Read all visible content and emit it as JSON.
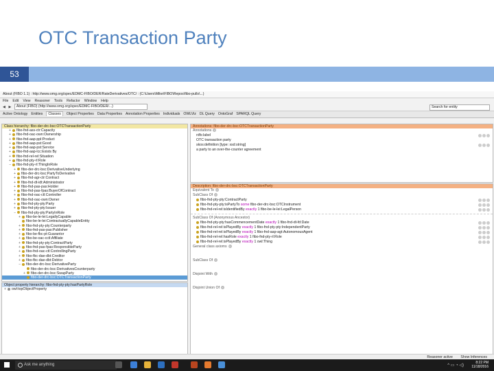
{
  "slide": {
    "title": "OTC Transaction Party",
    "page_number": "53"
  },
  "window": {
    "title": "About (FIBO 1.1) : http://www.omg.org/spec/EDMC-FIBO/DER/RateDerivatives/OTC/ : (C:\\Users\\Mike\\FIBO\\Repos\\fibo-pulls\\...)"
  },
  "menu": [
    "File",
    "Edit",
    "View",
    "Reasoner",
    "Tools",
    "Refactor",
    "Window",
    "Help"
  ],
  "toolbar": {
    "url": "About (FIBO) (http://www.omg.org/spec/EDMC-FIBO/DER/...)",
    "search_placeholder": "Search for entity"
  },
  "tabs": [
    "Active Ontology",
    "Entities",
    "Classes",
    "Object Properties",
    "Data Properties",
    "Annotation Properties",
    "Individuals",
    "OWLViz",
    "DL Query",
    "OntoGraf",
    "SPARQL Query"
  ],
  "active_tab": "Classes",
  "class_hierarchy": {
    "header": "Class hierarchy: fibo-der-drc-bsc:OTCTransactionParty",
    "items": [
      {
        "label": "fibo-fnd-ass-ctr:Capacity",
        "indent": 1,
        "toggle": "+"
      },
      {
        "label": "fibo-fnd-oac-own:Ownership",
        "indent": 1,
        "toggle": "+"
      },
      {
        "label": "fibo-fnd-aap-ppl:Product",
        "indent": 1,
        "toggle": "+"
      },
      {
        "label": "fibo-fnd-aap-pst:Good",
        "indent": 1,
        "toggle": "+"
      },
      {
        "label": "fibo-fnd-aap-pst:Service",
        "indent": 1,
        "toggle": "+"
      },
      {
        "label": "fibo-fnd-aap-lcc:Exists By",
        "indent": 1,
        "toggle": "+"
      },
      {
        "label": "fibo-fnd-rel-rel:Situation",
        "indent": 1,
        "toggle": "+"
      },
      {
        "label": "fibo-fnd-pty-rl:Role",
        "indent": 1,
        "toggle": "+"
      },
      {
        "label": "fibo-fnd-pty-rl:ThingInRole",
        "indent": 1,
        "toggle": "−"
      },
      {
        "label": "fibo-der-drc-bsc:DerivativeUnderlying",
        "indent": 2,
        "toggle": "+"
      },
      {
        "label": "fibo-der-drc-bsc:PartyToDerivative",
        "indent": 2,
        "toggle": "+"
      },
      {
        "label": "fibo-fnd-agr-ctr:Contract",
        "indent": 2,
        "toggle": "+"
      },
      {
        "label": "fibo-fnd-dt-idt:Administrator",
        "indent": 2,
        "toggle": "+"
      },
      {
        "label": "fibo-fnd-pas-pas:Holder",
        "indent": 2,
        "toggle": "+"
      },
      {
        "label": "fibo-fnd-pas-fpas:BuyerOfContract",
        "indent": 2,
        "toggle": "+"
      },
      {
        "label": "fibo-fnd-oac-ctl:Controller",
        "indent": 2,
        "toggle": "+"
      },
      {
        "label": "fibo-fnd-oac-own:Owner",
        "indent": 2,
        "toggle": "+"
      },
      {
        "label": "fibo-fnd-pty-pty:Party",
        "indent": 2,
        "toggle": "+"
      },
      {
        "label": "fibo-fnd-pty-pty:Issuer",
        "indent": 2,
        "toggle": "+"
      },
      {
        "label": "fibo-fnd-pty-pty:PartyInRole",
        "indent": 2,
        "toggle": "−"
      },
      {
        "label": "fibo-be-le-lei:LegallyCapable",
        "indent": 3,
        "toggle": "+"
      },
      {
        "label": "fibo-be-le-lei:ContractuallyCapableEntity",
        "indent": 3,
        "toggle": ""
      },
      {
        "label": "fibo-fnd-pty-pty:Counterparty",
        "indent": 3,
        "toggle": "+"
      },
      {
        "label": "fibo-fnd-pas-pas:Publisher",
        "indent": 3,
        "toggle": "+"
      },
      {
        "label": "fibo-be-fbc-pt:Guarantor",
        "indent": 3,
        "toggle": "+"
      },
      {
        "label": "fibo-be-oac-cctl:Affiliate",
        "indent": 3,
        "toggle": "+"
      },
      {
        "label": "fibo-fnd-pty-pty:ContractParty",
        "indent": 3,
        "toggle": "+"
      },
      {
        "label": "fibo-fnd-pas-fpas:ResponsibleParty",
        "indent": 3,
        "toggle": "+"
      },
      {
        "label": "fibo-fnd-oac-ctl:ControllingParty",
        "indent": 3,
        "toggle": "+"
      },
      {
        "label": "fibo-fbc-dae-dbt:Creditor",
        "indent": 3,
        "toggle": "+"
      },
      {
        "label": "fibo-fbc-dae-dbt:Debtor",
        "indent": 3,
        "toggle": "+"
      },
      {
        "label": "fibo-der-drc-bsc:DerivativeParty",
        "indent": 3,
        "toggle": "−"
      },
      {
        "label": "fibo-der-drc-bsc:DerivativesCounterparty",
        "indent": 4,
        "toggle": ""
      },
      {
        "label": "fibo-der-drc-bsc:SwapParty",
        "indent": 4,
        "toggle": "+"
      },
      {
        "label": "fibo-der-drc-bsc:OTCTransactionParty",
        "indent": 4,
        "toggle": "",
        "selected": true
      }
    ]
  },
  "object_hierarchy": {
    "header": "Object property hierarchy: fibo-fnd-pty-pty:hasPartyRole",
    "items": [
      {
        "label": "owl:topObjectProperty",
        "indent": 0,
        "toggle": "+"
      }
    ]
  },
  "annotations": {
    "header": "Annotations: fibo-der-drc-bsc:OTCTransactionParty",
    "section_label": "Annotations",
    "items": [
      {
        "key": "rdfs:label",
        "value": ""
      },
      {
        "key": "",
        "value": "OTC transaction party"
      },
      {
        "key": "skos:definition",
        "value": "[type: xsd:string]"
      },
      {
        "key": "",
        "value": "a party to an over-the-counter agreement"
      }
    ]
  },
  "description": {
    "header": "Description: fibo-der-drc-bsc:OTCTransactionParty",
    "equivalent_label": "Equivalent To",
    "subclass_label": "SubClass Of",
    "subclass_items": [
      {
        "pre": "fibo-fnd-pty-pty:ContractParty",
        "kw": "",
        "post": ""
      },
      {
        "pre": "fibo-fnd-pty-pty:isPartyTo",
        "kw": "some",
        "post": "fibo-der-drc-bsc:OTCInstrument"
      },
      {
        "pre": "fibo-fnd-rel-rel:isIdentifiedBy",
        "kw": "exactly",
        "post": "1 fibo-be-le-lei:LegalPerson"
      }
    ],
    "inherited_label": "SubClass Of (Anonymous Ancestor)",
    "inherited_items": [
      {
        "pre": "fibo-fnd-pty-pty:hasCommencementDate",
        "kw": "exactly",
        "post": "1 fibo-fnd-dt-fd:Date"
      },
      {
        "pre": "fibo-fnd-rel-rel:isPlayedBy",
        "kw": "exactly",
        "post": "1 fibo-fnd-pty-pty:IndependentParty"
      },
      {
        "pre": "fibo-fnd-rel-rel:isPlayedBy",
        "kw": "exactly",
        "post": "1 fibo-fnd-aap-agt:AutonomousAgent"
      },
      {
        "pre": "fibo-fnd-rel-rel:hasRole",
        "kw": "exactly",
        "post": "1 fibo-fnd-pty-rl:Role"
      },
      {
        "pre": "fibo-fnd-rel-rel:isPlayedBy",
        "kw": "exactly",
        "post": "1 owl:Thing"
      }
    ],
    "other_sections": [
      "General class axioms",
      "SubClass Of",
      "Disjoint With",
      "Disjoint Union Of"
    ]
  },
  "statusbar": {
    "reasoner": "Reasoner active",
    "show_inferences": "Show Inferences"
  },
  "taskbar": {
    "search_placeholder": "Ask me anything",
    "time": "8:22 PM",
    "date": "11/18/2016"
  },
  "colors": {
    "title": "#4f81bd",
    "bar": "#8eb4e3",
    "page_box": "#2f5597",
    "selected": "#5b9bd5",
    "class_dot": "#c9a21f"
  }
}
